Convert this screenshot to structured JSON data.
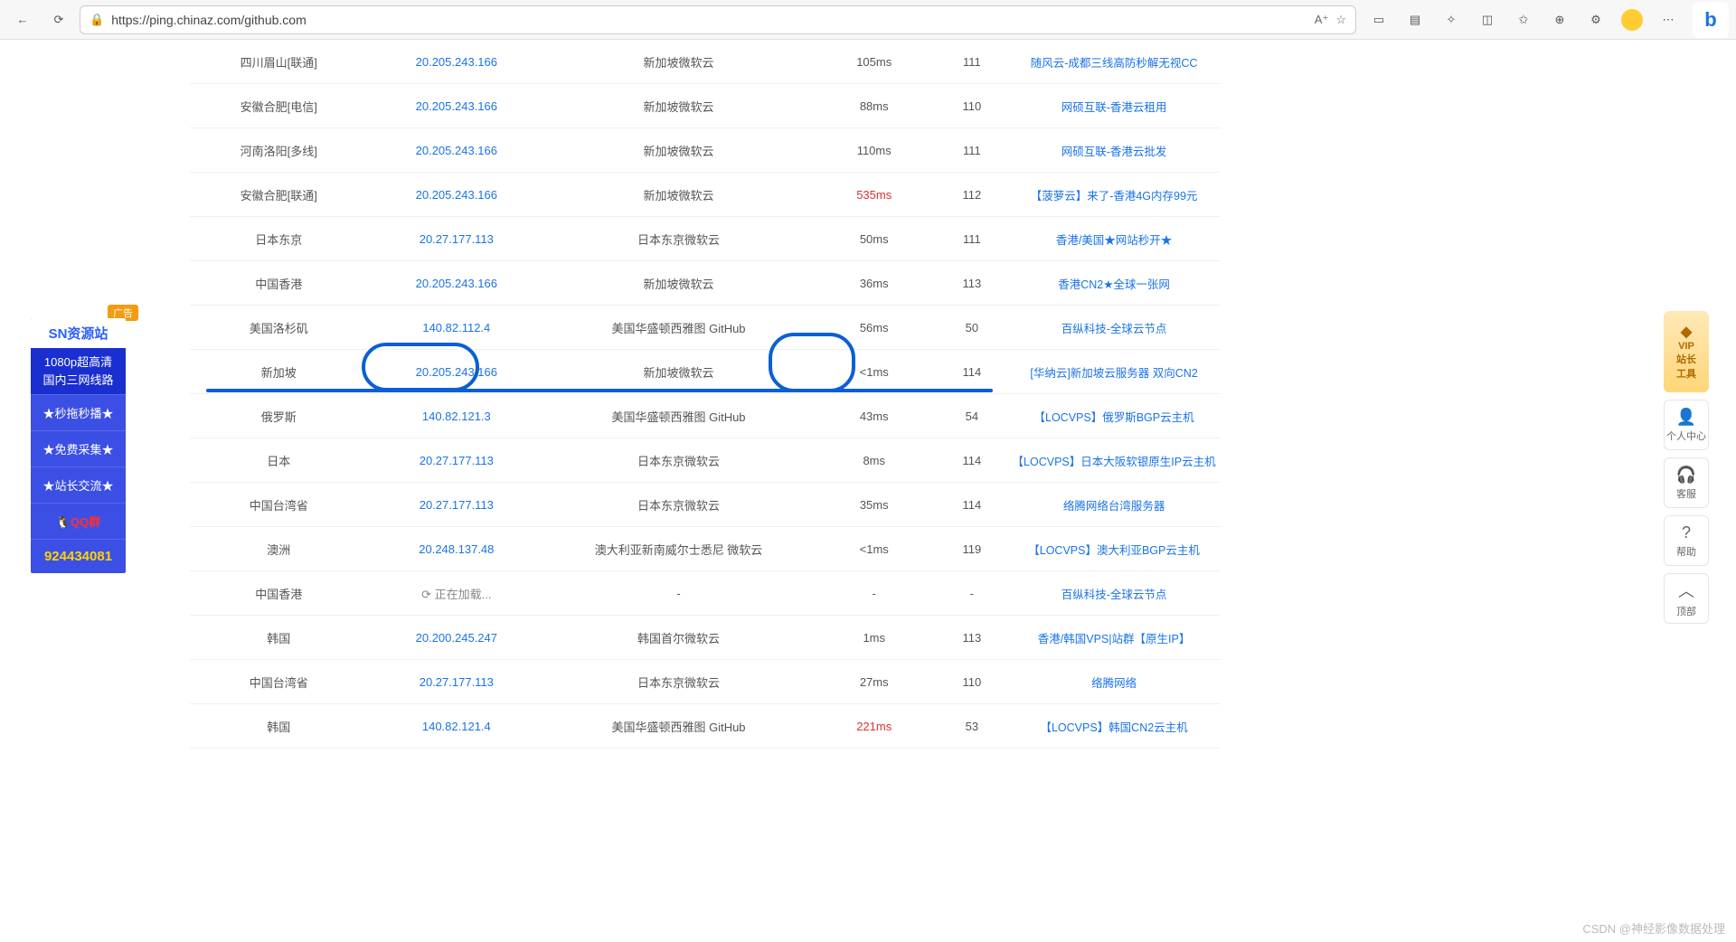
{
  "browser": {
    "url": "https://ping.chinaz.com/github.com",
    "lock_icon": "lock-icon"
  },
  "ad": {
    "badge": "广告",
    "title": "SN资源站",
    "line1": "1080p超高清",
    "line2": "国内三网线路",
    "items": [
      "秒拖秒播",
      "免费采集",
      "站长交流"
    ],
    "qq_label": "QQ群",
    "qq_num": "924434081"
  },
  "right_tools": {
    "vip_line1": "VIP",
    "vip_line2": "站长",
    "vip_line3": "工具",
    "personal": "个人中心",
    "service": "客服",
    "help": "帮助",
    "top": "顶部"
  },
  "loading_text": "正在加载...",
  "rows": [
    {
      "loc": "四川眉山[联通]",
      "ip": "20.205.243.166",
      "region": "新加坡微软云",
      "lat": "105ms",
      "hop": "111",
      "sponsor": "随风云-成都三线高防秒解无视CC"
    },
    {
      "loc": "安徽合肥[电信]",
      "ip": "20.205.243.166",
      "region": "新加坡微软云",
      "lat": "88ms",
      "hop": "110",
      "sponsor": "网硕互联-香港云租用"
    },
    {
      "loc": "河南洛阳[多线]",
      "ip": "20.205.243.166",
      "region": "新加坡微软云",
      "lat": "110ms",
      "hop": "111",
      "sponsor": "网硕互联-香港云批发"
    },
    {
      "loc": "安徽合肥[联通]",
      "ip": "20.205.243.166",
      "region": "新加坡微软云",
      "lat": "535ms",
      "hop": "112",
      "sponsor": "【菠萝云】来了-香港4G内存99元",
      "lat_red": true
    },
    {
      "loc": "日本东京",
      "ip": "20.27.177.113",
      "region": "日本东京微软云",
      "lat": "50ms",
      "hop": "111",
      "sponsor": "香港/美国★网站秒开★"
    },
    {
      "loc": "中国香港",
      "ip": "20.205.243.166",
      "region": "新加坡微软云",
      "lat": "36ms",
      "hop": "113",
      "sponsor": "香港CN2★全球一张网"
    },
    {
      "loc": "美国洛杉矶",
      "ip": "140.82.112.4",
      "region": "美国华盛顿西雅图 GitHub",
      "lat": "56ms",
      "hop": "50",
      "sponsor": "百纵科技-全球云节点"
    },
    {
      "loc": "新加坡",
      "ip": "20.205.243.166",
      "region": "新加坡微软云",
      "lat": "<1ms",
      "hop": "114",
      "sponsor": "[华纳云]新加坡云服务器 双向CN2"
    },
    {
      "loc": "俄罗斯",
      "ip": "140.82.121.3",
      "region": "美国华盛顿西雅图 GitHub",
      "lat": "43ms",
      "hop": "54",
      "sponsor": "【LOCVPS】俄罗斯BGP云主机"
    },
    {
      "loc": "日本",
      "ip": "20.27.177.113",
      "region": "日本东京微软云",
      "lat": "8ms",
      "hop": "114",
      "sponsor": "【LOCVPS】日本大阪软银原生IP云主机"
    },
    {
      "loc": "中国台湾省",
      "ip": "20.27.177.113",
      "region": "日本东京微软云",
      "lat": "35ms",
      "hop": "114",
      "sponsor": "络腾网络台湾服务器"
    },
    {
      "loc": "澳洲",
      "ip": "20.248.137.48",
      "region": "澳大利亚新南威尔士悉尼 微软云",
      "lat": "<1ms",
      "hop": "119",
      "sponsor": "【LOCVPS】澳大利亚BGP云主机"
    },
    {
      "loc": "中国香港",
      "ip": "",
      "region": "-",
      "lat": "-",
      "hop": "-",
      "sponsor": "百纵科技-全球云节点",
      "loading": true
    },
    {
      "loc": "韩国",
      "ip": "20.200.245.247",
      "region": "韩国首尔微软云",
      "lat": "1ms",
      "hop": "113",
      "sponsor": "香港/韩国VPS|站群【原生IP】"
    },
    {
      "loc": "中国台湾省",
      "ip": "20.27.177.113",
      "region": "日本东京微软云",
      "lat": "27ms",
      "hop": "110",
      "sponsor": "络腾网络"
    },
    {
      "loc": "韩国",
      "ip": "140.82.121.4",
      "region": "美国华盛顿西雅图 GitHub",
      "lat": "221ms",
      "hop": "53",
      "sponsor": "【LOCVPS】韩国CN2云主机",
      "lat_red": true
    }
  ],
  "watermark": "CSDN @神经影像数据处理"
}
